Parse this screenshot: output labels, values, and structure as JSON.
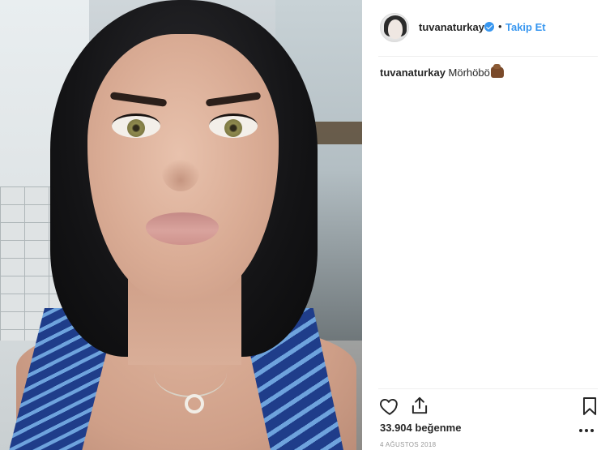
{
  "post": {
    "image_alt": "",
    "username": "tuvanaturkay",
    "verified": true,
    "separator": "•",
    "follow_label": "Takip Et",
    "caption": {
      "username": "tuvanaturkay",
      "text": "Mörhöbö",
      "emoji": "hand-emoji"
    },
    "likes": "33.904 beğenme",
    "date": "4 AĞUSTOS 2018"
  },
  "icons": {
    "like": "heart-icon",
    "share": "share-icon",
    "save": "bookmark-icon",
    "more": "more-options-icon",
    "verified": "verified-badge-icon"
  },
  "colors": {
    "accent": "#3897f0",
    "text": "#262626",
    "muted": "#999999",
    "divider": "#efefef"
  }
}
